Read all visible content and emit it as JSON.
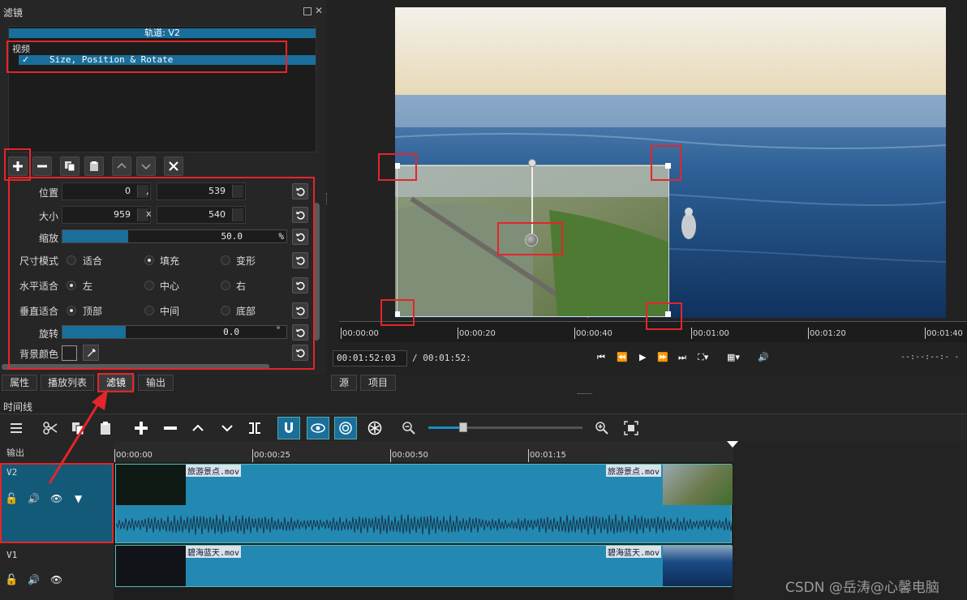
{
  "filters_panel": {
    "title": "滤镜",
    "track_header": "轨道: V2",
    "category": "视频",
    "filter_item": "Size, Position & Rotate",
    "filter_checked": "✓"
  },
  "props": {
    "position_label": "位置",
    "position_x": "0",
    "position_sep": ",",
    "position_y": "539",
    "size_label": "大小",
    "size_w": "959",
    "size_sep": "x",
    "size_h": "540",
    "zoom_label": "缩放",
    "zoom_value": "50.0",
    "zoom_unit": "%",
    "zoom_percent": 50,
    "size_mode_label": "尺寸模式",
    "size_mode_options": [
      "适合",
      "填充",
      "变形"
    ],
    "h_fit_label": "水平适合",
    "h_fit_options": [
      "左",
      "中心",
      "右"
    ],
    "v_fit_label": "垂直适合",
    "v_fit_options": [
      "顶部",
      "中间",
      "底部"
    ],
    "rotate_label": "旋转",
    "rotate_value": "0.0",
    "rotate_unit": "°",
    "rotate_fraction": 0.23,
    "bg_color_label": "背景颜色"
  },
  "left_tabs": [
    "属性",
    "播放列表",
    "滤镜",
    "输出"
  ],
  "right_tabs": [
    "源",
    "项目"
  ],
  "player": {
    "ruler_labels": [
      "00:00:00",
      "00:00:20",
      "00:00:40",
      "00:01:00",
      "00:01:20",
      "00:01:40"
    ],
    "current_time": "00:01:52:03",
    "total_time": "/ 00:01:52:",
    "right_time": "--:--:--:- -"
  },
  "timeline": {
    "title": "时间线",
    "output_label": "输出",
    "ruler_labels": [
      "00:00:00",
      "00:00:25",
      "00:00:50",
      "00:01:15"
    ],
    "tracks": [
      {
        "name": "V2",
        "clip_label": "旅游景点.mov"
      },
      {
        "name": "V1",
        "clip_label": "碧海蓝天.mov"
      }
    ]
  },
  "watermark": "CSDN @岳涛@心馨电脑",
  "colors": {
    "accent": "#1a6e9a",
    "highlight_red": "#e5252a",
    "clip_blue": "#2389b3"
  }
}
